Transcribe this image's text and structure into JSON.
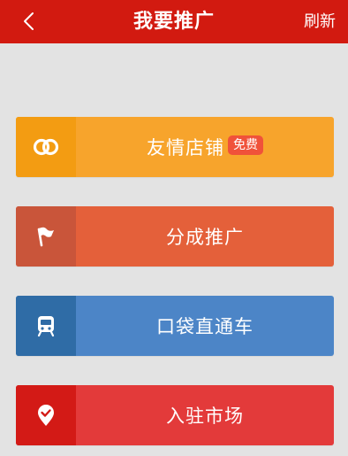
{
  "header": {
    "title": "我要推广",
    "refresh_label": "刷新",
    "background": "#d21a10"
  },
  "menu": [
    {
      "label": "友情店铺",
      "badge": "免费",
      "badge_color": "#f0523a",
      "icon": "rings-icon",
      "icon_bg": "#f39c12",
      "bg": "#f7a42c"
    },
    {
      "label": "分成推广",
      "icon": "flag-icon",
      "icon_bg": "#c9553a",
      "bg": "#e4603a"
    },
    {
      "label": "口袋直通车",
      "icon": "train-icon",
      "icon_bg": "#2f6ca6",
      "bg": "#4c85c7"
    },
    {
      "label": "入驻市场",
      "icon": "location-check-icon",
      "icon_bg": "#d31a16",
      "bg": "#e33a3a"
    }
  ]
}
